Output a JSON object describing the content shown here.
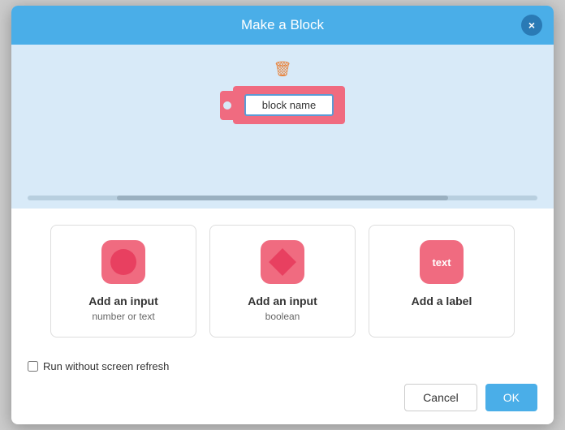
{
  "header": {
    "title": "Make a Block",
    "close_label": "×"
  },
  "preview": {
    "block_name_placeholder": "block name",
    "block_name_value": "block name"
  },
  "options": [
    {
      "id": "input-number-text",
      "title": "Add an input",
      "subtitle": "number or text",
      "icon_type": "circle"
    },
    {
      "id": "input-boolean",
      "title": "Add an input",
      "subtitle": "boolean",
      "icon_type": "diamond"
    },
    {
      "id": "add-label",
      "title": "Add a label",
      "subtitle": "",
      "icon_type": "text"
    }
  ],
  "footer": {
    "checkbox_label": "Run without screen refresh",
    "cancel_label": "Cancel",
    "ok_label": "OK"
  },
  "colors": {
    "header_bg": "#4aaee8",
    "preview_bg": "#d8eaf8",
    "block_color": "#f06b80",
    "accent": "#4aaee8"
  }
}
